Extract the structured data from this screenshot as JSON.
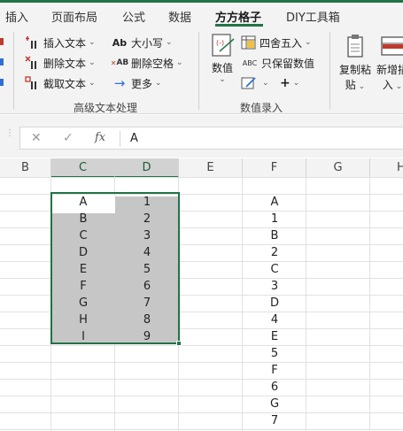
{
  "tabs": [
    "插入",
    "页面布局",
    "公式",
    "数据",
    "方方格子",
    "DIY工具箱"
  ],
  "active_tab": "方方格子",
  "ribbon": {
    "text_group": {
      "label": "高级文本处理",
      "insert_text": "插入文本",
      "delete_text": "删除文本",
      "cut_text": "截取文本",
      "case": "大小写",
      "delete_space": "删除空格",
      "more": "更多",
      "case_icon_text": "Ab",
      "space_icon_text": "AB"
    },
    "number_group": {
      "label": "数值录入",
      "value_button": "数值",
      "round": "四舍五入",
      "keep_value": "只保留数值",
      "keep_value_icon_text": "ABC",
      "plus": "+"
    },
    "copy_group": {
      "copy_paste_line1": "复制粘",
      "copy_paste_line2": "贴",
      "insert_line1": "新增插",
      "insert_line2": "入"
    }
  },
  "formula_bar": {
    "cancel": "✕",
    "confirm": "✓",
    "fx": "fx",
    "value": "A"
  },
  "columns": [
    "B",
    "C",
    "D",
    "E",
    "F",
    "G",
    "H"
  ],
  "selected_columns": [
    "C",
    "D"
  ],
  "col_c": [
    "A",
    "B",
    "C",
    "D",
    "E",
    "F",
    "G",
    "H",
    "I"
  ],
  "col_d": [
    "1",
    "2",
    "3",
    "4",
    "5",
    "6",
    "7",
    "8",
    "9"
  ],
  "col_f": [
    "A",
    "1",
    "B",
    "2",
    "C",
    "3",
    "D",
    "4",
    "E",
    "5",
    "F",
    "6",
    "G",
    "7"
  ],
  "colors": {
    "accent": "#217346",
    "selection_fill": "#c6c6c6",
    "header_selected": "#d2d2d2"
  }
}
